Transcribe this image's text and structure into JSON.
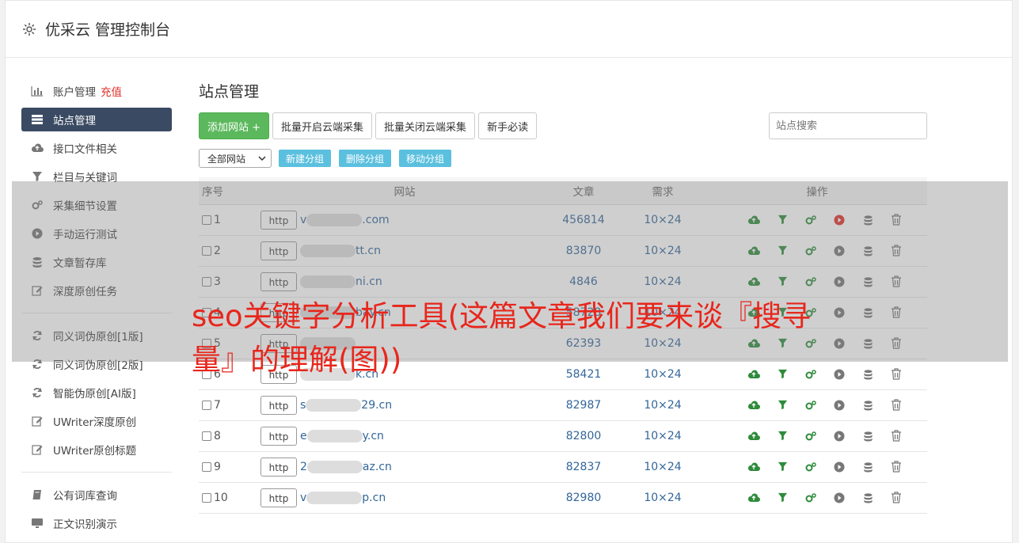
{
  "header": {
    "title": "优采云 管理控制台",
    "icon": "gear-icon"
  },
  "sidebar": {
    "items": [
      {
        "label": "账户管理",
        "extra": "充值",
        "icon": "bar-chart-icon"
      },
      {
        "label": "站点管理",
        "icon": "server-icon",
        "active": true
      },
      {
        "label": "接口文件相关",
        "icon": "cloud-upload-icon"
      },
      {
        "label": "栏目与关键词",
        "icon": "filter-icon"
      },
      {
        "label": "采集细节设置",
        "icon": "gears-icon"
      },
      {
        "label": "手动运行测试",
        "icon": "play-circle-icon"
      },
      {
        "label": "文章暂存库",
        "icon": "database-icon"
      },
      {
        "label": "深度原创任务",
        "icon": "edit-icon"
      },
      {
        "label": "同义词伪原创[1版]",
        "icon": "refresh-icon"
      },
      {
        "label": "同义词伪原创[2版]",
        "icon": "refresh-icon"
      },
      {
        "label": "智能伪原创[AI版]",
        "icon": "refresh-icon"
      },
      {
        "label": "UWriter深度原创",
        "icon": "edit-icon"
      },
      {
        "label": "UWriter原创标题",
        "icon": "edit-icon"
      },
      {
        "label": "公有词库查询",
        "icon": "book-icon"
      },
      {
        "label": "正文识别演示",
        "icon": "monitor-icon"
      }
    ]
  },
  "main": {
    "title": "站点管理",
    "toolbar": {
      "add_site": "添加网站 +",
      "batch_open": "批量开启云端采集",
      "batch_close": "批量关闭云端采集",
      "guide": "新手必读",
      "search_placeholder": "站点搜索"
    },
    "group_bar": {
      "select_value": "全部网站",
      "new_group": "新建分组",
      "delete_group": "删除分组",
      "move_group": "移动分组"
    },
    "table": {
      "headers": [
        "序号",
        "网站",
        "文章",
        "需求",
        "操作"
      ],
      "rows": [
        {
          "no": "1",
          "proto": "http",
          "prefix": "v",
          "suffix": ".com",
          "articles": "456814",
          "demand": "10×24",
          "running": true
        },
        {
          "no": "2",
          "proto": "http",
          "prefix": "",
          "suffix": "tt.cn",
          "articles": "83870",
          "demand": "10×24",
          "running": false
        },
        {
          "no": "3",
          "proto": "http",
          "prefix": "",
          "suffix": "ni.cn",
          "articles": "4846",
          "demand": "10×24",
          "running": false
        },
        {
          "no": "4",
          "proto": "http",
          "prefix": "",
          "suffix": "bay.cn",
          "articles": "58728",
          "demand": "10×24",
          "running": false
        },
        {
          "no": "5",
          "proto": "http",
          "prefix": "",
          "suffix": "",
          "articles": "62393",
          "demand": "10×24",
          "running": false
        },
        {
          "no": "6",
          "proto": "http",
          "prefix": "",
          "suffix": "k.cn",
          "articles": "58421",
          "demand": "10×24",
          "running": false
        },
        {
          "no": "7",
          "proto": "http",
          "prefix": "s",
          "suffix": "29.cn",
          "articles": "82987",
          "demand": "10×24",
          "running": false
        },
        {
          "no": "8",
          "proto": "http",
          "prefix": "e",
          "suffix": "y.cn",
          "articles": "82800",
          "demand": "10×24",
          "running": false
        },
        {
          "no": "9",
          "proto": "http",
          "prefix": "2",
          "suffix": "az.cn",
          "articles": "82837",
          "demand": "10×24",
          "running": false
        },
        {
          "no": "10",
          "proto": "http",
          "prefix": "v",
          "suffix": "p.cn",
          "articles": "82980",
          "demand": "10×24",
          "running": false
        }
      ]
    }
  },
  "overlay": {
    "text": "seo关键字分析工具(这篇文章我们要来谈『搜寻量』的理解(图))"
  },
  "colors": {
    "accent": "#3a4a63",
    "green": "#5cb85c",
    "info": "#5bc0de",
    "link": "#336699",
    "overlay_text": "#e8261c",
    "run_red": "#e0302b"
  }
}
